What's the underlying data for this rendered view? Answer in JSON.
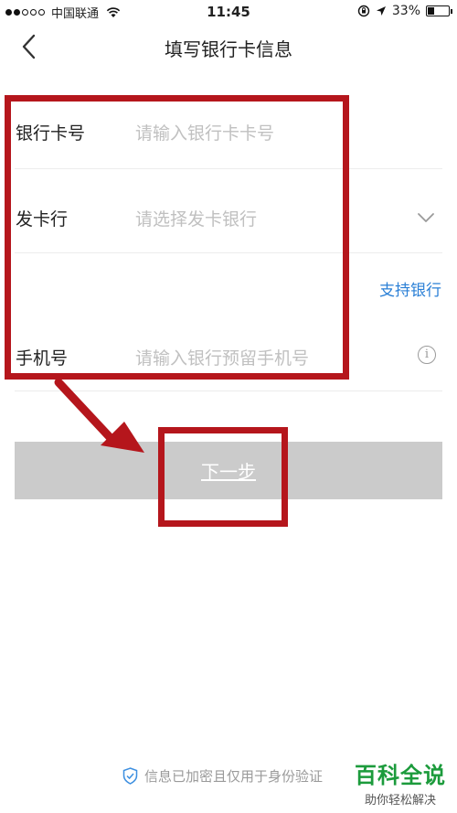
{
  "status_bar": {
    "carrier": "中国联通",
    "time": "11:45",
    "battery_percent": "33%",
    "battery_level": 0.33,
    "icons": [
      "signal-icon",
      "wifi-icon",
      "rotation-lock-icon",
      "location-icon",
      "battery-icon"
    ]
  },
  "nav": {
    "title": "填写银行卡信息",
    "back_icon": "chevron-left-icon"
  },
  "form": {
    "card_number": {
      "label": "银行卡号",
      "placeholder": "请输入银行卡卡号"
    },
    "issuing_bank": {
      "label": "发卡行",
      "placeholder": "请选择发卡银行",
      "icon": "chevron-down-icon"
    },
    "support_link": "支持银行",
    "phone": {
      "label": "手机号",
      "placeholder": "请输入银行预留手机号",
      "icon": "info-icon"
    }
  },
  "next_button": {
    "label": "下一步"
  },
  "footer": {
    "security_note": "信息已加密且仅用于身份验证",
    "icon": "shield-check-icon"
  },
  "watermark": {
    "title": "百科全说",
    "subtitle": "助你轻松解决"
  },
  "colors": {
    "annotation_red": "#b5161c",
    "link_blue": "#2a7fd6",
    "button_disabled": "#cbcbcb",
    "watermark_green": "#1c9b3c"
  }
}
